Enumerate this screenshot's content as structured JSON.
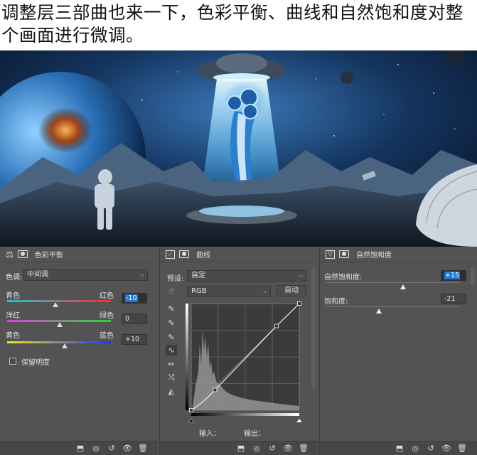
{
  "article": {
    "caption": "调整层三部曲也来一下，色彩平衡、曲线和自然饱和度对整个画面进行微调。"
  },
  "artwork": {
    "scene": "sci-fi moon landscape with shaver in UFO beam"
  },
  "color_balance": {
    "panel_title": "色彩平衡",
    "tone_label": "色调:",
    "tone_value": "中间调",
    "sliders": [
      {
        "left": "青色",
        "right": "红色",
        "value": "-10",
        "fraction": 0.45,
        "selected": true
      },
      {
        "left": "洋红",
        "right": "绿色",
        "value": "0",
        "fraction": 0.5,
        "selected": false
      },
      {
        "left": "黄色",
        "right": "蓝色",
        "value": "+10",
        "fraction": 0.55,
        "selected": false
      }
    ],
    "preserve_luminosity_label": "保留明度"
  },
  "curves": {
    "panel_title": "曲线",
    "preset_label": "预设:",
    "preset_value": "自定",
    "channel_value": "RGB",
    "auto_label": "自动",
    "input_label": "输入：",
    "output_label": "输出：",
    "points": [
      [
        0,
        0
      ],
      [
        0.22,
        0.19
      ],
      [
        0.79,
        0.79
      ],
      [
        1,
        1
      ]
    ]
  },
  "vibrance": {
    "panel_title": "自然饱和度",
    "vibrance_label": "自然饱和度:",
    "vibrance_value": "+15",
    "vibrance_fraction": 0.575,
    "saturation_label": "饱和度:",
    "saturation_value": "-21",
    "saturation_fraction": 0.395
  },
  "footer_icons": [
    "clip-to-layer-icon",
    "view-previous-icon",
    "reset-icon",
    "visibility-eye-icon",
    "trash-icon"
  ]
}
